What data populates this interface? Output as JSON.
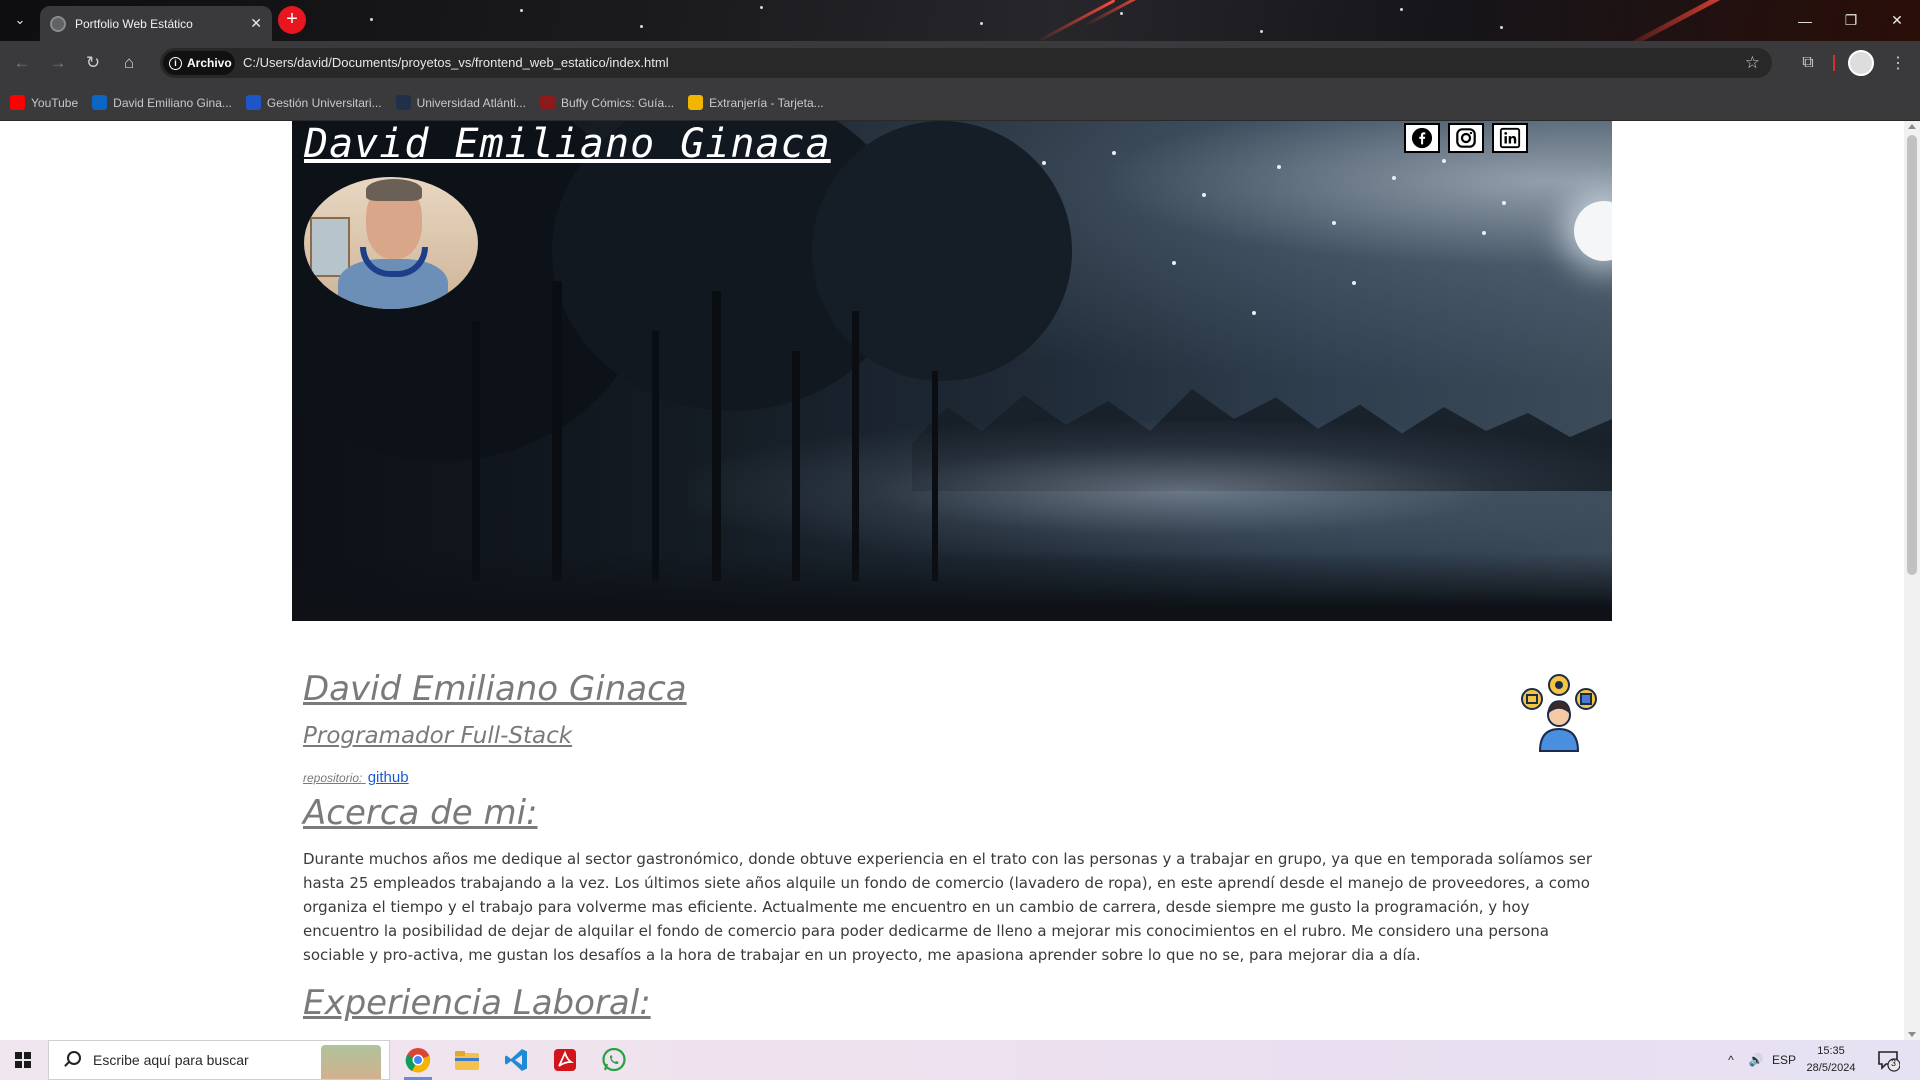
{
  "browser": {
    "tab_title": "Portfolio Web Estático",
    "site_chip_label": "Archivo",
    "url": "C:/Users/david/Documents/proyetos_vs/frontend_web_estatico/index.html",
    "bookmarks": [
      {
        "label": "YouTube",
        "color": "#ff0000"
      },
      {
        "label": "David Emiliano Gina...",
        "color": "#0a66c2"
      },
      {
        "label": "Gestión Universitari...",
        "color": "#1e56c9"
      },
      {
        "label": "Universidad Atlánti...",
        "color": "#20304a"
      },
      {
        "label": "Buffy Cómics: Guía...",
        "color": "#8b1a1a"
      },
      {
        "label": "Extranjería - Tarjeta...",
        "color": "#f2b600"
      }
    ]
  },
  "page": {
    "hero_name": "David Emiliano Ginaca",
    "social": [
      "facebook-icon",
      "instagram-icon",
      "linkedin-icon"
    ],
    "name_heading": "David Emiliano Ginaca",
    "role": "Programador Full-Stack",
    "repo_label": "repositorio:",
    "repo_link": "github",
    "about_heading": "Acerca de mi:",
    "about_text": "Durante muchos años me dedique al sector gastronómico, donde obtuve experiencia en el trato con las personas y a trabajar en grupo, ya que en temporada solíamos ser hasta 25 empleados trabajando a la vez. Los últimos siete años alquile un fondo de comercio (lavadero de ropa), en este aprendí desde el manejo de proveedores, a como organiza el tiempo y el trabajo para volverme mas eficiente. Actualmente me encuentro en un cambio de carrera, desde siempre me gusto la programación, y hoy encuentro la posibilidad de dejar de alquilar el fondo de comercio para poder dedicarme de lleno a mejorar mis conocimientos en el rubro. Me considero una persona sociable y pro-activa, me gustan los desafíos a la hora de trabajar en un proyecto, me apasiona aprender sobre lo que no se, para mejorar dia a día.",
    "experience_heading": "Experiencia Laboral:"
  },
  "taskbar": {
    "search_placeholder": "Escribe aquí para buscar",
    "language": "ESP",
    "time": "15:35",
    "date": "28/5/2024",
    "notification_count": "3"
  }
}
